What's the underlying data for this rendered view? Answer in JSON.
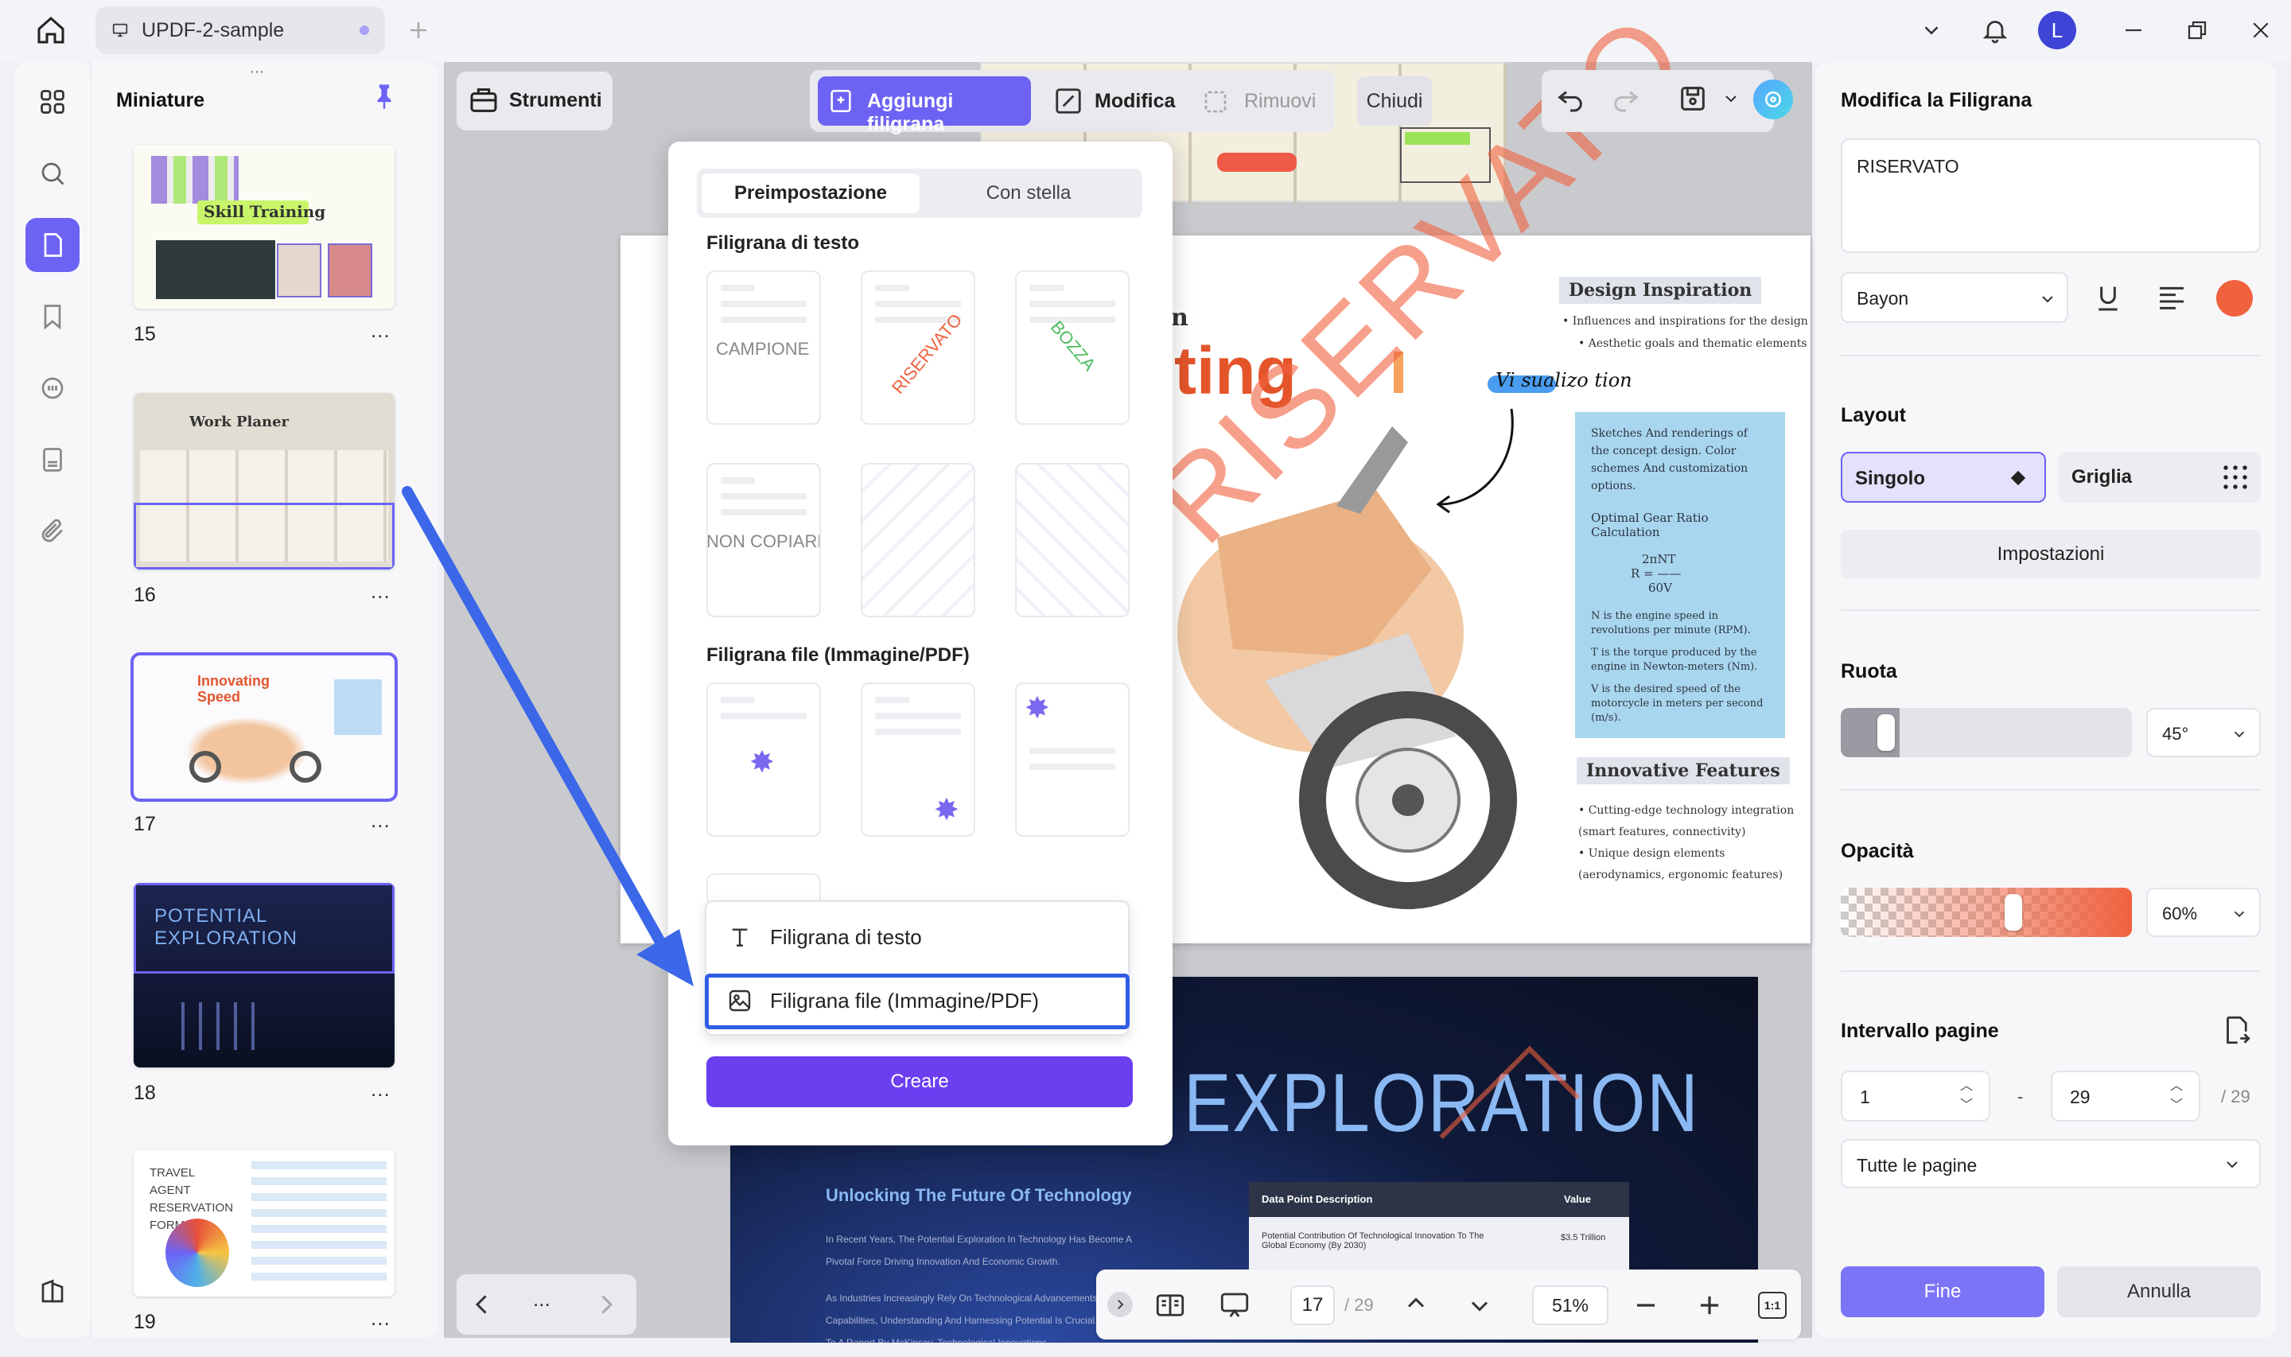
{
  "app": {
    "tab_title": "UPDF-2-sample",
    "avatar_letter": "L"
  },
  "thumbnails": {
    "title": "Miniature",
    "more": "...",
    "pages": [
      {
        "number": "15",
        "caption": "Skill Training"
      },
      {
        "number": "16",
        "caption": "Work Planer"
      },
      {
        "number": "17",
        "caption": "Innovating Speed"
      },
      {
        "number": "18",
        "caption": "POTENTIAL EXPLORATION"
      },
      {
        "number": "19",
        "caption": "TRAVEL AGENT RESERVATION FORM"
      }
    ]
  },
  "toolbar": {
    "tools_label": "Strumenti",
    "add_watermark": "Aggiungi filigrana",
    "edit": "Modifica",
    "remove": "Rimuovi",
    "close": "Chiudi"
  },
  "popup": {
    "tab_preset": "Preimpostazione",
    "tab_starred": "Con stella",
    "text_section": "Filigrana di testo",
    "file_section": "Filigrana file (Immagine/PDF)",
    "presets": [
      "CAMPIONE",
      "RISERVATO",
      "BOZZA",
      "NON COPIARE"
    ],
    "menu": {
      "text_watermark": "Filigrana di testo",
      "file_watermark": "Filigrana file (Immagine/PDF)"
    },
    "create": "Creare"
  },
  "document": {
    "design_inspiration": "Design Inspiration",
    "bullet1": "• Influences and inspirations for the design",
    "bullet2": "• Aesthetic goals and thematic elements",
    "title_fragment": "ting",
    "n_fragment": "n",
    "visual_text": "Vi sualizo tion",
    "sketch_text": "Sketches And renderings of the concept design. Color schemes And customization options.",
    "gear_title": "Optimal Gear Ratio Calculation",
    "formula": "2πNT",
    "formula_r": "R = ——",
    "formula_d": "60V",
    "n_desc": "N is the engine speed in revolutions per minute (RPM).",
    "t_desc": "T is the torque produced by the engine in Newton-meters (Nm).",
    "v_desc": "V is the desired speed of the motorcycle in meters per second (m/s).",
    "innovative_features": "Innovative Features",
    "feat1": "• Cutting-edge technology integration (smart features, connectivity)",
    "feat2": "• Unique design elements (aerodynamics, ergonomic features)",
    "watermark_text": "RISERVATO",
    "exploration_title": "EXPLORATION",
    "exploration_subtitle": "Unlocking The Future Of Technology",
    "table_h1": "Data Point Description",
    "table_h2": "Value",
    "table_r1c1": "Potential Contribution Of Technological Innovation To The Global Economy (By 2030)",
    "table_r1c2": "$3.5 Trillion",
    "exploration_p1": "In Recent Years, The Potential Exploration In Technology Has Become A Pivotal Force Driving Innovation And Economic Growth.",
    "exploration_p2": "As Industries Increasingly Rely On Technological Advancements, Enhance Capabilities, Understanding And Harnessing Potential Is Crucial. According To A Report By McKinsey, Technological Innovations"
  },
  "bottom_nav": {
    "ellipsis": "...",
    "current_page": "17",
    "total_pages": "/ 29",
    "zoom": "51%",
    "fit": "1:1"
  },
  "right_panel": {
    "title": "Modifica la Filigrana",
    "text_value": "RISERVATO",
    "font": "Bayon",
    "color": "#f0613e",
    "layout_label": "Layout",
    "single": "Singolo",
    "grid": "Griglia",
    "settings": "Impostazioni",
    "rotate_label": "Ruota",
    "rotate_value": "45°",
    "opacity_label": "Opacità",
    "opacity_value": "60%",
    "opacity_level": 0.6,
    "range_label": "Intervallo pagine",
    "range_from": "1",
    "range_dash": "-",
    "range_to": "29",
    "range_total": "/ 29",
    "range_select": "Tutte le pagine",
    "finish": "Fine",
    "cancel": "Annulla"
  },
  "colors": {
    "accent": "#6c63f5",
    "arrow": "#3b67e8",
    "watermark": "#f0613e"
  }
}
